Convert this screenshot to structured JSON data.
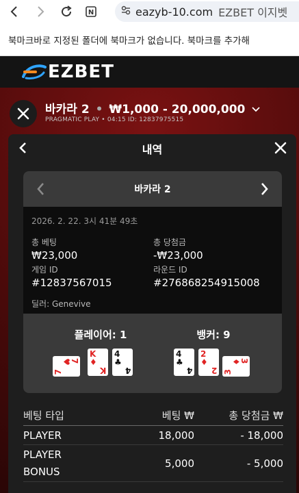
{
  "browser": {
    "url": "eazyb-10.com",
    "page_title": "EZBET 이지벳",
    "bookmark_notice": "북마크바로 지정된 폴더에 북마크가 없습니다. 북마크를 추가해"
  },
  "site": {
    "logo_text": "EZBET"
  },
  "game": {
    "name": "바카라 2",
    "limits": "₩1,000 - 20,000,000",
    "provider": "PRAGMATIC PLAY",
    "time": "04:15",
    "id_label": "ID: 12837975515"
  },
  "history": {
    "title": "내역",
    "round_title": "바카라 2",
    "datetime": "2026. 2. 22. 3시 41분 49초",
    "total_bet_label": "총 베팅",
    "total_bet_value": "₩23,000",
    "total_win_label": "총 당첨금",
    "total_win_value": "-₩23,000",
    "game_id_label": "게임 ID",
    "game_id_value": "#12837567015",
    "round_id_label": "라운드 ID",
    "round_id_value": "#276868254915008",
    "dealer": "딜러: Genevive",
    "player_label": "플레이어: 1",
    "banker_label": "뱅커: 9",
    "player_cards": [
      {
        "rank": "7",
        "suit": "♥",
        "color": "red"
      },
      {
        "rank": "K",
        "suit": "♦",
        "color": "red"
      },
      {
        "rank": "4",
        "suit": "♣",
        "color": "black"
      }
    ],
    "banker_cards": [
      {
        "rank": "4",
        "suit": "♣",
        "color": "black"
      },
      {
        "rank": "2",
        "suit": "♦",
        "color": "red"
      },
      {
        "rank": "3",
        "suit": "♦",
        "color": "red"
      }
    ]
  },
  "bets": {
    "headers": {
      "type": "베팅 타입",
      "bet": "베팅 ₩",
      "win": "총 당첨금 ₩"
    },
    "rows": [
      {
        "type": "PLAYER",
        "bet": "18,000",
        "win": "- 18,000"
      },
      {
        "type": "PLAYER BONUS",
        "bet": "5,000",
        "win": "- 5,000"
      }
    ]
  }
}
